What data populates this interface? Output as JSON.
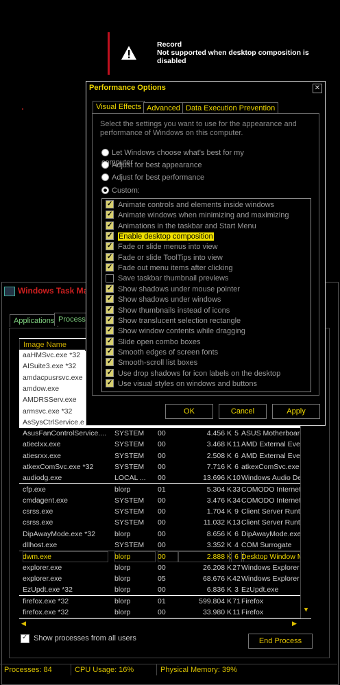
{
  "notification": {
    "title": "Record",
    "message": "Not supported when desktop composition is disabled"
  },
  "task_manager": {
    "title": "Windows Task Mar",
    "tabs": [
      "Applications",
      "Processes"
    ],
    "column_header": "Image Name",
    "visible_white_rows": [
      {
        "name": "aaHMSvc.exe *32"
      },
      {
        "name": "AISuite3.exe *32"
      },
      {
        "name": "amdacpusrsvc.exe"
      },
      {
        "name": "amdow.exe"
      },
      {
        "name": "AMDRSServ.exe"
      },
      {
        "name": "armsvc.exe *32"
      },
      {
        "name": "AsSysCtrlService.e"
      }
    ],
    "rows": [
      {
        "name": "AsusFanControlService....",
        "user": "SYSTEM",
        "cpu": "00",
        "mem": "4.456 K",
        "threads": "5",
        "desc": "ASUS Motherboard"
      },
      {
        "name": "atiecIxx.exe",
        "user": "SYSTEM",
        "cpu": "00",
        "mem": "3.468 K",
        "threads": "11",
        "desc": "AMD External Even"
      },
      {
        "name": "atiesrxx.exe",
        "user": "SYSTEM",
        "cpu": "00",
        "mem": "2.508 K",
        "threads": "6",
        "desc": "AMD External Even"
      },
      {
        "name": "atkexComSvc.exe *32",
        "user": "SYSTEM",
        "cpu": "00",
        "mem": "7.716 K",
        "threads": "6",
        "desc": "atkexComSvc.exe"
      },
      {
        "name": "audiodg.exe",
        "user": "LOCAL ...",
        "cpu": "00",
        "mem": "13.696 K",
        "threads": "10",
        "desc": "Windows Audio De"
      },
      {
        "name": "cfp.exe",
        "user": "blorp",
        "cpu": "01",
        "mem": "5.304 K",
        "threads": "33",
        "desc": "COMODO Internet"
      },
      {
        "name": "cmdagent.exe",
        "user": "SYSTEM",
        "cpu": "00",
        "mem": "3.476 K",
        "threads": "34",
        "desc": "COMODO Internet"
      },
      {
        "name": "csrss.exe",
        "user": "SYSTEM",
        "cpu": "00",
        "mem": "1.704 K",
        "threads": "9",
        "desc": "Client Server Runt"
      },
      {
        "name": "csrss.exe",
        "user": "SYSTEM",
        "cpu": "00",
        "mem": "11.032 K",
        "threads": "13",
        "desc": "Client Server Runt"
      },
      {
        "name": "DipAwayMode.exe *32",
        "user": "blorp",
        "cpu": "00",
        "mem": "8.656 K",
        "threads": "6",
        "desc": "DipAwayMode.exe"
      },
      {
        "name": "dllhost.exe",
        "user": "SYSTEM",
        "cpu": "00",
        "mem": "3.352 K",
        "threads": "4",
        "desc": "COM Surrogate"
      },
      {
        "name": "dwm.exe",
        "user": "blorp",
        "cpu": "00",
        "mem": "2.888 K",
        "threads": "6",
        "desc": "Desktop Window M",
        "selected": true
      },
      {
        "name": "explorer.exe",
        "user": "blorp",
        "cpu": "00",
        "mem": "26.208 K",
        "threads": "27",
        "desc": "Windows Explorer"
      },
      {
        "name": "explorer.exe",
        "user": "blorp",
        "cpu": "05",
        "mem": "68.676 K",
        "threads": "42",
        "desc": "Windows Explorer"
      },
      {
        "name": "EzUpdt.exe *32",
        "user": "blorp",
        "cpu": "00",
        "mem": "6.836 K",
        "threads": "3",
        "desc": "EzUpdt.exe"
      },
      {
        "name": "firefox.exe *32",
        "user": "blorp",
        "cpu": "01",
        "mem": "599.804 K",
        "threads": "71",
        "desc": "Firefox"
      },
      {
        "name": "firefox.exe *32",
        "user": "blorp",
        "cpu": "00",
        "mem": "33.980 K",
        "threads": "11",
        "desc": "Firefox"
      }
    ],
    "show_all_label": "Show processes from all users",
    "show_all_checked": true,
    "end_process_label": "End Process",
    "status": {
      "processes": "Processes: 84",
      "cpu": "CPU Usage: 16%",
      "memory": "Physical Memory: 39%"
    }
  },
  "performance_options": {
    "title": "Performance Options",
    "close_glyph": "✕",
    "tabs": [
      "Visual Effects",
      "Advanced",
      "Data Execution Prevention"
    ],
    "active_tab": "Visual Effects",
    "description": "Select the settings you want to use for the appearance and performance of Windows on this computer.",
    "radio_options": [
      {
        "label": "Let Windows choose what's best for my computer",
        "selected": false
      },
      {
        "label": "Adjust for best appearance",
        "selected": false
      },
      {
        "label": "Adjust for best performance",
        "selected": false
      },
      {
        "label": "Custom:",
        "selected": true
      }
    ],
    "effects": [
      {
        "label": "Animate controls and elements inside windows",
        "checked": true
      },
      {
        "label": "Animate windows when minimizing and maximizing",
        "checked": true
      },
      {
        "label": "Animations in the taskbar and Start Menu",
        "checked": true
      },
      {
        "label": "Enable desktop composition",
        "checked": true,
        "highlighted": true
      },
      {
        "label": "Fade or slide menus into view",
        "checked": true
      },
      {
        "label": "Fade or slide ToolTips into view",
        "checked": true
      },
      {
        "label": "Fade out menu items after clicking",
        "checked": true
      },
      {
        "label": "Save taskbar thumbnail previews",
        "checked": false
      },
      {
        "label": "Show shadows under mouse pointer",
        "checked": true
      },
      {
        "label": "Show shadows under windows",
        "checked": true
      },
      {
        "label": "Show thumbnails instead of icons",
        "checked": true
      },
      {
        "label": "Show translucent selection rectangle",
        "checked": true
      },
      {
        "label": "Show window contents while dragging",
        "checked": true
      },
      {
        "label": "Slide open combo boxes",
        "checked": true
      },
      {
        "label": "Smooth edges of screen fonts",
        "checked": true
      },
      {
        "label": "Smooth-scroll list boxes",
        "checked": true
      },
      {
        "label": "Use drop shadows for icon labels on the desktop",
        "checked": true
      },
      {
        "label": "Use visual styles on windows and buttons",
        "checked": true
      }
    ],
    "buttons": {
      "ok": "OK",
      "cancel": "Cancel",
      "apply": "Apply"
    }
  }
}
